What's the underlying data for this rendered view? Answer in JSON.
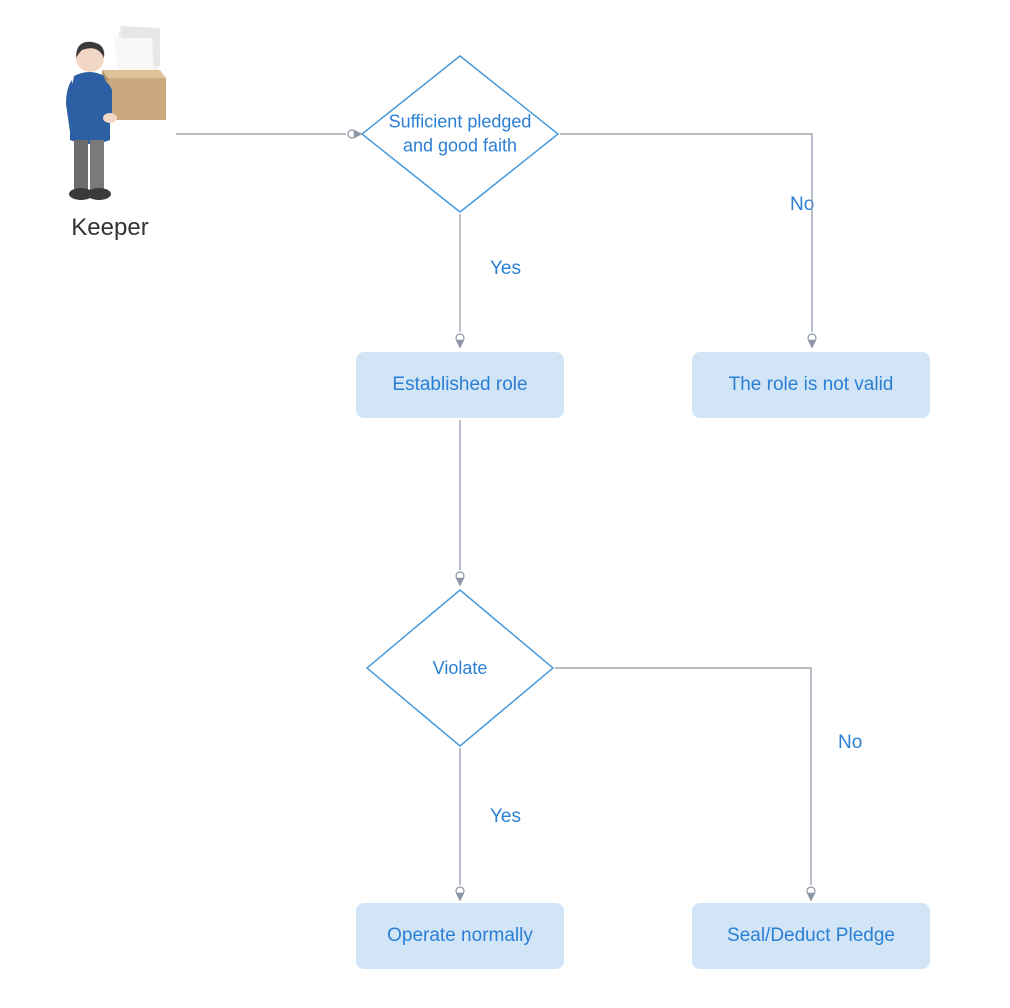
{
  "actor": {
    "label": "Keeper"
  },
  "nodes": {
    "decision1": "Sufficient pledged and good faith",
    "decision2": "Violate",
    "process_established": "Established role",
    "process_invalid": "The role is not valid",
    "process_normal": "Operate normally",
    "process_seal": "Seal/Deduct Pledge"
  },
  "edges": {
    "yes1": "Yes",
    "no1": "No",
    "yes2": "Yes",
    "no2": "No"
  },
  "colors": {
    "node_fill": "#d1e5f7",
    "text_blue": "#2a7fd4",
    "stroke_gray": "#8d96a5",
    "decision_stroke": "#4a9bdc"
  }
}
